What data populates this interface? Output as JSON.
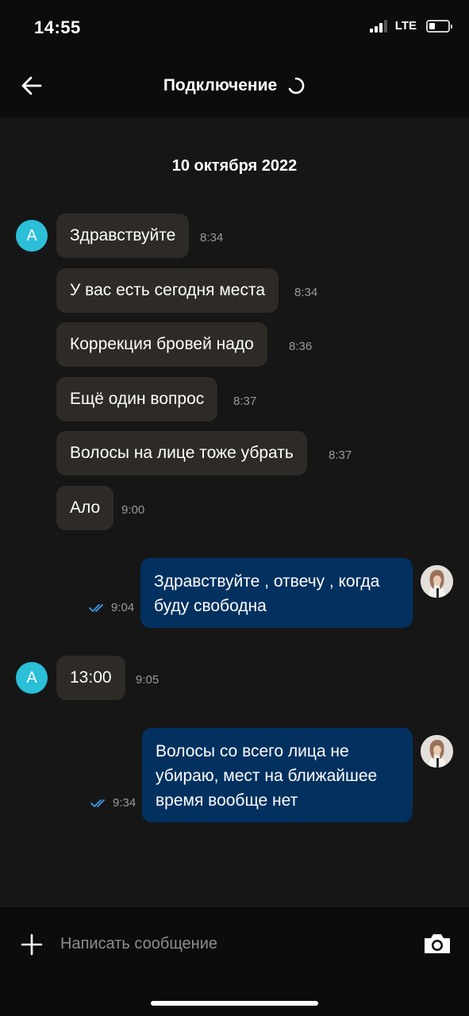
{
  "status_bar": {
    "time": "14:55",
    "network": "LTE",
    "battery_level": 0.3
  },
  "header": {
    "title": "Подключение"
  },
  "chat": {
    "date": "10 октября 2022",
    "incoming_avatar_letter": "A",
    "messages": [
      {
        "direction": "in",
        "text": "Здравствуйте",
        "time": "8:34"
      },
      {
        "direction": "in",
        "text": "У вас есть сегодня места",
        "time": "8:34"
      },
      {
        "direction": "in",
        "text": "Коррекция бровей надо",
        "time": "8:36"
      },
      {
        "direction": "in",
        "text": "Ещё один вопрос",
        "time": "8:37"
      },
      {
        "direction": "in",
        "text": "Волосы на лице тоже убрать",
        "time": "8:37"
      },
      {
        "direction": "in",
        "text": "Ало",
        "time": "9:00"
      },
      {
        "direction": "out",
        "lines": [
          "Здравствуйте , отвечу , когда",
          "буду свободна"
        ],
        "time": "9:04",
        "read": true
      },
      {
        "direction": "in",
        "text": "13:00",
        "time": "9:05"
      },
      {
        "direction": "out",
        "lines": [
          "Волосы со всего лица не",
          "убираю, мест на ближайшее",
          "время вообще нет"
        ],
        "time": "9:34",
        "read": true
      }
    ]
  },
  "composer": {
    "placeholder": "Написать сообщение"
  },
  "colors": {
    "accent": "#2bbfd8",
    "outgoing_bubble": "#023160",
    "incoming_bubble": "#2e2b27",
    "read_check": "#3a9be8"
  }
}
